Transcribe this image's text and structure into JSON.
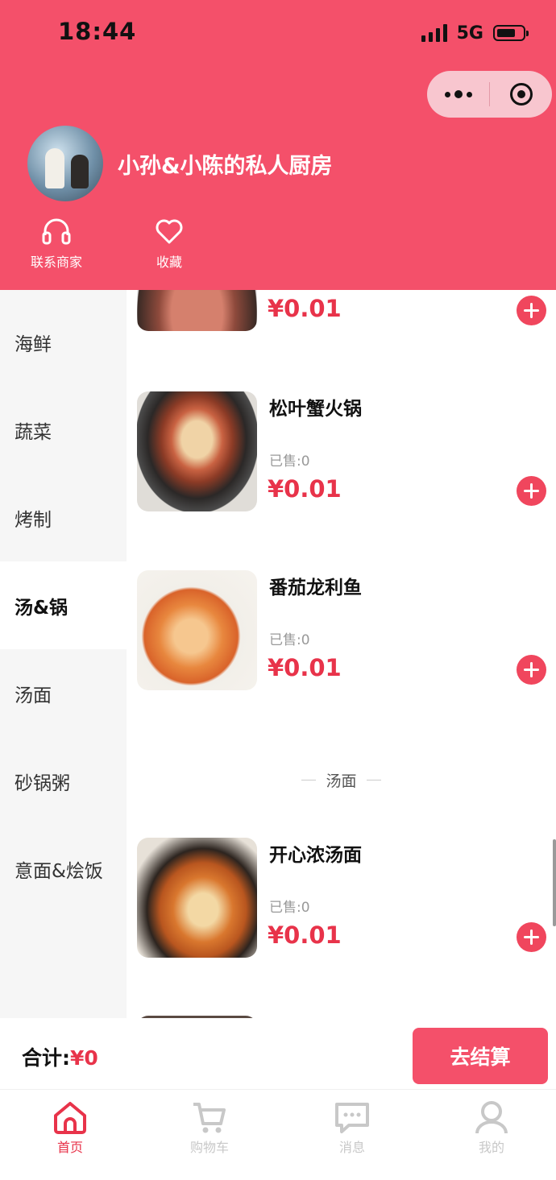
{
  "status_bar": {
    "time": "18:44",
    "network": "5G"
  },
  "header": {
    "shop_name": "小孙&小陈的私人厨房",
    "actions": [
      {
        "label": "联系商家",
        "icon": "headset-icon"
      },
      {
        "label": "收藏",
        "icon": "heart-icon"
      }
    ]
  },
  "sidebar": {
    "categories": [
      "海鲜",
      "蔬菜",
      "烤制",
      "汤&锅",
      "汤面",
      "砂锅粥",
      "意面&烩饭"
    ],
    "active": "汤&锅"
  },
  "menu": {
    "partial_item": {
      "price": "¥0.01"
    },
    "items": [
      {
        "name": "松叶蟹火锅",
        "sold": "已售:0",
        "price": "¥0.01"
      },
      {
        "name": "番茄龙利鱼",
        "sold": "已售:0",
        "price": "¥0.01"
      },
      {
        "name": "开心浓汤面",
        "sold": "已售:0",
        "price": "¥0.01"
      }
    ],
    "section_header": "汤面"
  },
  "cart": {
    "total_label": "合计:",
    "total_value": "¥0",
    "checkout_label": "去结算"
  },
  "tabbar": {
    "tabs": [
      {
        "label": "首页",
        "icon": "home-icon",
        "active": true
      },
      {
        "label": "购物车",
        "icon": "cart-icon",
        "active": false
      },
      {
        "label": "消息",
        "icon": "message-icon",
        "active": false
      },
      {
        "label": "我的",
        "icon": "user-icon",
        "active": false
      }
    ]
  },
  "colors": {
    "brand": "#f4506a",
    "price": "#e8334a",
    "inactive_tab": "#c8c8c8"
  }
}
